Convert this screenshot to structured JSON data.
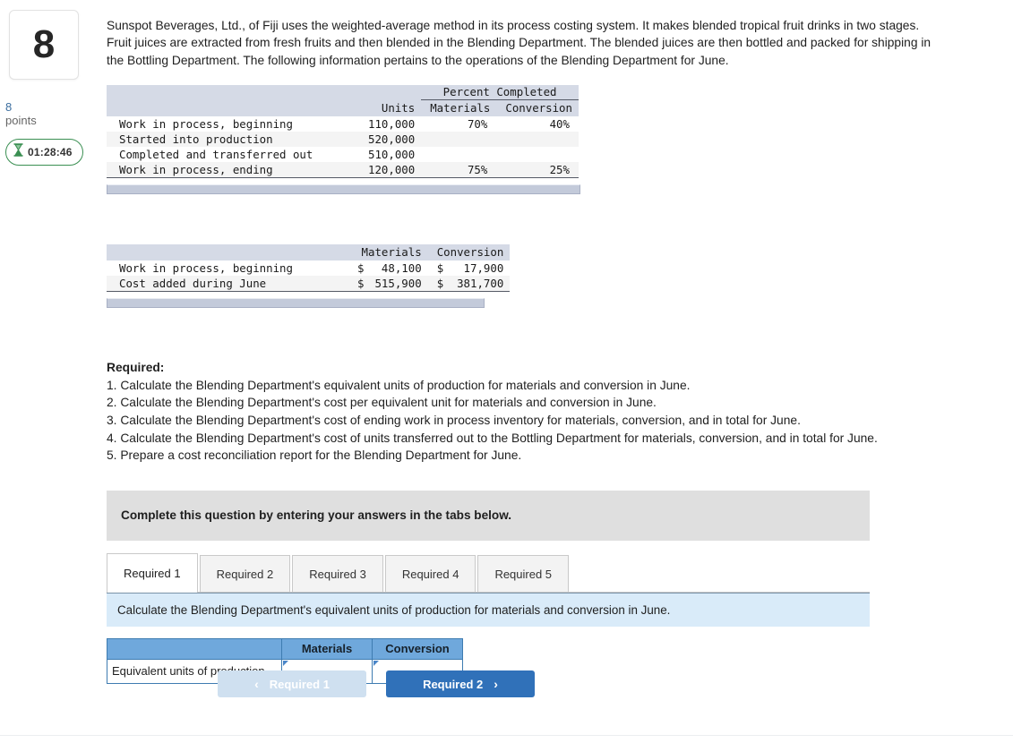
{
  "question": {
    "number": "8",
    "points_value": "8",
    "points_label": "points",
    "timer": "01:28:46",
    "timer_icon": "hourglass-icon"
  },
  "intro": "Sunspot Beverages, Ltd., of Fiji uses the weighted-average method in its process costing system. It makes blended tropical fruit drinks in two stages. Fruit juices are extracted from fresh fruits and then blended in the Blending Department. The blended juices are then bottled and packed for shipping in the Bottling Department. The following information pertains to the operations of the Blending Department for June.",
  "units_table": {
    "group_header": "Percent Completed",
    "columns": [
      "",
      "Units",
      "Materials",
      "Conversion"
    ],
    "rows": [
      {
        "label": "Work in process, beginning",
        "units": "110,000",
        "materials": "70%",
        "conversion": "40%"
      },
      {
        "label": "Started into production",
        "units": "520,000",
        "materials": "",
        "conversion": ""
      },
      {
        "label": "Completed and transferred out",
        "units": "510,000",
        "materials": "",
        "conversion": ""
      },
      {
        "label": "Work in process, ending",
        "units": "120,000",
        "materials": "75%",
        "conversion": "25%"
      }
    ]
  },
  "cost_table": {
    "columns": [
      "",
      "Materials",
      "Conversion"
    ],
    "rows": [
      {
        "label": "Work in process, beginning",
        "materials_symbol": "$",
        "materials": "48,100",
        "conversion_symbol": "$",
        "conversion": "17,900"
      },
      {
        "label": "Cost added during June",
        "materials_symbol": "$",
        "materials": "515,900",
        "conversion_symbol": "$",
        "conversion": "381,700"
      }
    ]
  },
  "required": {
    "title": "Required:",
    "items": [
      "1. Calculate the Blending Department's equivalent units of production for materials and conversion in June.",
      "2. Calculate the Blending Department's cost per equivalent unit for materials and conversion in June.",
      "3. Calculate the Blending Department's cost of ending work in process inventory for materials, conversion, and in total for June.",
      "4. Calculate the Blending Department's cost of units transferred out to the Bottling Department for materials, conversion, and in total for June.",
      "5. Prepare a cost reconciliation report for the Blending Department for June."
    ]
  },
  "complete_bar": "Complete this question by entering your answers in the tabs below.",
  "tabs": [
    {
      "label": "Required 1",
      "active": true
    },
    {
      "label": "Required 2",
      "active": false
    },
    {
      "label": "Required 3",
      "active": false
    },
    {
      "label": "Required 4",
      "active": false
    },
    {
      "label": "Required 5",
      "active": false
    }
  ],
  "tab_banner": "Calculate the Blending Department's equivalent units of production for materials and conversion in June.",
  "answer_grid": {
    "corner": "",
    "col_materials": "Materials",
    "col_conversion": "Conversion",
    "row_label": "Equivalent units of production",
    "materials_value": "",
    "conversion_value": ""
  },
  "nav": {
    "prev_label": "Required 1",
    "prev_chevron": "‹",
    "next_label": "Required 2",
    "next_chevron": "›"
  }
}
